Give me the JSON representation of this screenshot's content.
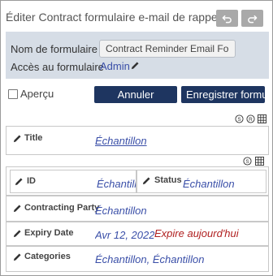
{
  "header": {
    "title": "Éditer Contract formulaire e-mail de rappel",
    "undo_icon": "undo-icon",
    "redo_icon": "redo-icon"
  },
  "settings": {
    "name_label": "Nom de formulaire",
    "name_value": "Contract Reminder Email Form",
    "access_label": "Accès au formulaire",
    "access_value": "Admin"
  },
  "toolbar": {
    "preview_label": "Aperçu",
    "cancel_label": "Annuler",
    "save_label": "Enregistrer formu"
  },
  "fields": {
    "title": {
      "label": "Title",
      "value": "Échantillon"
    },
    "id": {
      "label": "ID",
      "value": "Échantill"
    },
    "status": {
      "label": "Status",
      "value": "Échantillon"
    },
    "contracting_party": {
      "label": "Contracting Party",
      "value": "Échantillon"
    },
    "expiry_date": {
      "label": "Expiry Date",
      "value": "Avr 12, 2022",
      "note": "Expire aujourd'hui"
    },
    "categories": {
      "label": "Categories",
      "value": "Échantillon, Échantillon"
    }
  },
  "colors": {
    "accent_button": "#1e3560",
    "link": "#3a4fa8",
    "settings_bg": "#d6dde6",
    "warning": "#b02020"
  }
}
